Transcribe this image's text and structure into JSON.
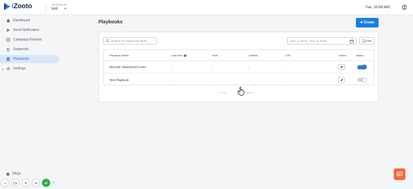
{
  "header": {
    "logo_text_i": "i",
    "logo_text_rest": "Zooto",
    "account_label": "All Accounts",
    "account_name": "test",
    "clock": "Tue, 10:56 AM"
  },
  "sidebar": {
    "items": [
      {
        "label": "Dashboard",
        "icon": "home-icon"
      },
      {
        "label": "Send Notification",
        "icon": "send-icon"
      },
      {
        "label": "Campaign Reports",
        "icon": "reports-icon"
      },
      {
        "label": "Segments",
        "icon": "segments-icon"
      },
      {
        "label": "Playbooks",
        "icon": "playbooks-icon",
        "active": true
      },
      {
        "label": "Settings",
        "icon": "gear-icon"
      }
    ],
    "faqs": "FAQs"
  },
  "page": {
    "title": "Playbooks",
    "create_label": "Create"
  },
  "toolbar": {
    "search_placeholder": "Search by Playbook name",
    "date_range": "Dec 1, 2019 - Dec 4, 2019",
    "csv_label": "CSV"
  },
  "table": {
    "headers": [
      "Playbook Name",
      "Last sent",
      "Sent",
      "Clicked",
      "CTR",
      "Action",
      "Status"
    ],
    "rows": [
      {
        "name": "Recover Abandoned Carts",
        "last_sent": "-",
        "sent": "-",
        "clicked": "-",
        "ctr": "-",
        "status": "on"
      },
      {
        "name": "Test Playbook",
        "last_sent": "-",
        "sent": "-",
        "clicked": "-",
        "ctr": "-",
        "status": "off"
      }
    ]
  },
  "pagination": {
    "prev": "« Prev",
    "next": "Next »"
  },
  "colors": {
    "accent": "#1b7fe0",
    "active_nav_bg": "#d8e6f7",
    "chat": "#f26b3a",
    "ok": "#27b24a"
  }
}
